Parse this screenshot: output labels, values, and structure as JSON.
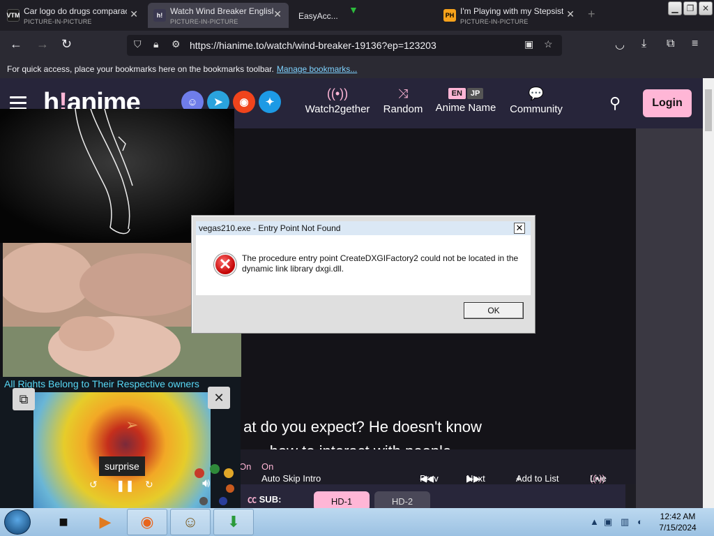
{
  "browser": {
    "tabs": [
      {
        "favicon": "VTM",
        "title": "Car logo do drugs comparac",
        "subtitle": "PICTURE-IN-PICTURE",
        "active": false
      },
      {
        "favicon": "h!",
        "title": "Watch Wind Breaker English",
        "subtitle": "PICTURE-IN-PICTURE",
        "active": true
      },
      {
        "favicon": "",
        "title": "EasyAcc...",
        "subtitle": "",
        "active": false
      },
      {
        "favicon": "PH",
        "title": "I'm Playing with my Stepsist",
        "subtitle": "PICTURE-IN-PICTURE",
        "active": false
      }
    ],
    "url": "https://hianime.to/watch/wind-breaker-19136?ep=123203",
    "bookmarks_msg": "For quick access, place your bookmarks here on the bookmarks toolbar.",
    "bookmarks_link": "Manage bookmarks..."
  },
  "site": {
    "logo_a": "h",
    "logo_b": "!",
    "logo_c": "anime",
    "nav": [
      {
        "icon": "broadcast-icon",
        "glyph": "((•))",
        "label": "Watch2gether"
      },
      {
        "icon": "shuffle-icon",
        "glyph": "⤨",
        "label": "Random"
      },
      {
        "icon": "language-toggle",
        "glyph": "",
        "label": "Anime Name"
      },
      {
        "icon": "chat-icon",
        "glyph": "💬",
        "label": "Community"
      }
    ],
    "lang_en": "EN",
    "lang_jp": "JP",
    "login": "Login",
    "subtitle_line1": "at do you expect? He doesn't know",
    "subtitle_line2": "how to interact with people.",
    "controls": {
      "autonext_state": "On",
      "auto_skip_label": "Auto Skip Intro",
      "auto_skip_state": "On",
      "prev": "Prev",
      "next": "Next",
      "add_to_list": "Add to List",
      "live": "Live"
    },
    "sub_label": "SUB:",
    "servers": [
      "HD-1",
      "HD-2"
    ]
  },
  "pip": {
    "rights_text": "All Rights Belong to Their Respective owners",
    "caption": "surprise"
  },
  "dialog": {
    "title": "vegas210.exe - Entry Point Not Found",
    "message": "The procedure entry point CreateDXGIFactory2 could not be located in the dynamic link library dxgi.dll.",
    "ok": "OK"
  },
  "taskbar": {
    "time": "12:42 AM",
    "date": "7/15/2024"
  }
}
